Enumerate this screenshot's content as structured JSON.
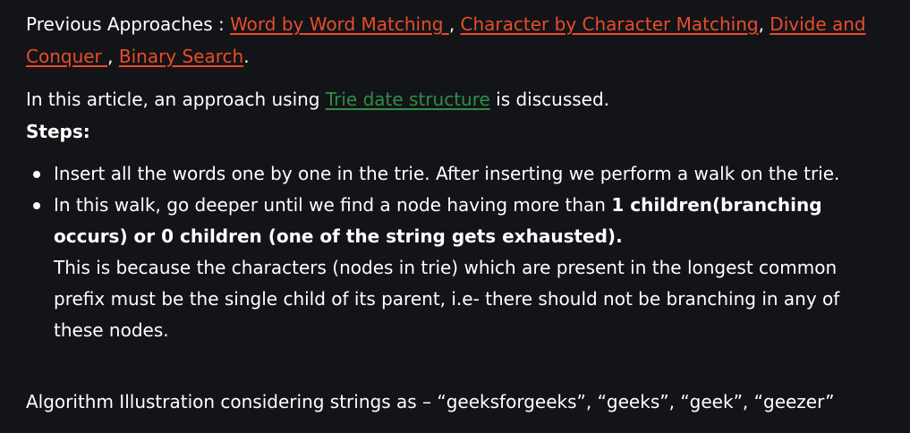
{
  "intro": {
    "prefix": "Previous Approaches : ",
    "link1": "Word by Word Matching ",
    "sep1": ", ",
    "link2": "Character by Character Matching",
    "sep2": ", ",
    "link3": "Divide and Conquer ",
    "sep3": ", ",
    "link4": "Binary Search",
    "suffix": "."
  },
  "article": {
    "prefix": "In this article, an approach using ",
    "link": "Trie date structure",
    "suffix": " is discussed."
  },
  "steps_heading": "Steps:",
  "steps": [
    {
      "text": "Insert all the words one by one in the trie. After inserting we perform a walk on the trie."
    },
    {
      "text": "In this walk, go deeper until we find a node having more than ",
      "bold": "1 children(branching occurs) or 0 children (one of the string gets exhausted).",
      "extra": "This is because the characters (nodes in trie) which are present in the longest common prefix must be the single child of its parent, i.e- there should not be branching in any of these nodes."
    }
  ],
  "illustration": "Algorithm Illustration considering strings as – “geeksforgeeks”, “geeks”, “geek”, “geezer”",
  "colors": {
    "background": "#131417",
    "text": "#ffffff",
    "link_red": "#ea4c2b",
    "link_green": "#2f8d46"
  }
}
